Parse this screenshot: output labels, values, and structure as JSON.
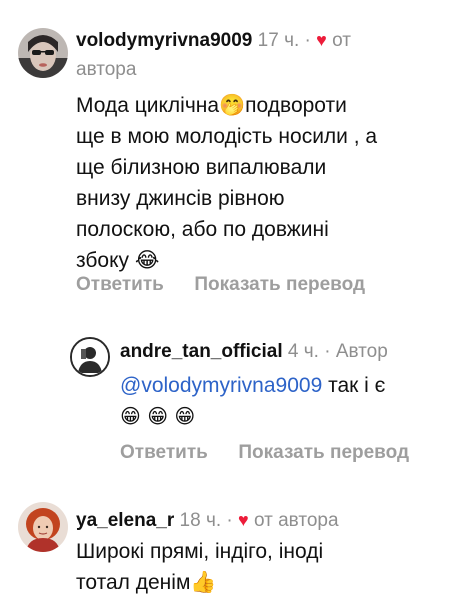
{
  "comments": [
    {
      "username": "volodymyrivna9009",
      "time": "17 ч.",
      "dot": "·",
      "heart": "♥",
      "badge_line1": "от",
      "badge_line2": "автора",
      "text_lines": [
        "Мода циклічна🤭подвороти",
        "ще в мою молодість носили , а",
        "ще білизною випалювали",
        "внизу джинсів рівною",
        "полоскою, або по довжині",
        "збоку 😂"
      ],
      "reply_label": "Ответить",
      "translate_label": "Показать перевод"
    },
    {
      "username": "andre_tan_official",
      "time": "4 ч.",
      "dot": "·",
      "badge": "Автор",
      "mention": "@volodymyrivna9009",
      "text_rest": " так і є",
      "emoji_line": "😁 😁 😁",
      "reply_label": "Ответить",
      "translate_label": "Показать перевод"
    },
    {
      "username": "ya_elena_r",
      "time": "18 ч.",
      "dot": "·",
      "heart": "♥",
      "badge": "от автора",
      "text_lines": [
        "Широкі прямі, індіго, іноді",
        "тотал денім👍"
      ]
    }
  ],
  "colors": {
    "heart": "#ed1c3a",
    "mention": "#2d63c8",
    "meta_gray": "#8e8e8e",
    "action_gray": "#9e9e9e"
  }
}
